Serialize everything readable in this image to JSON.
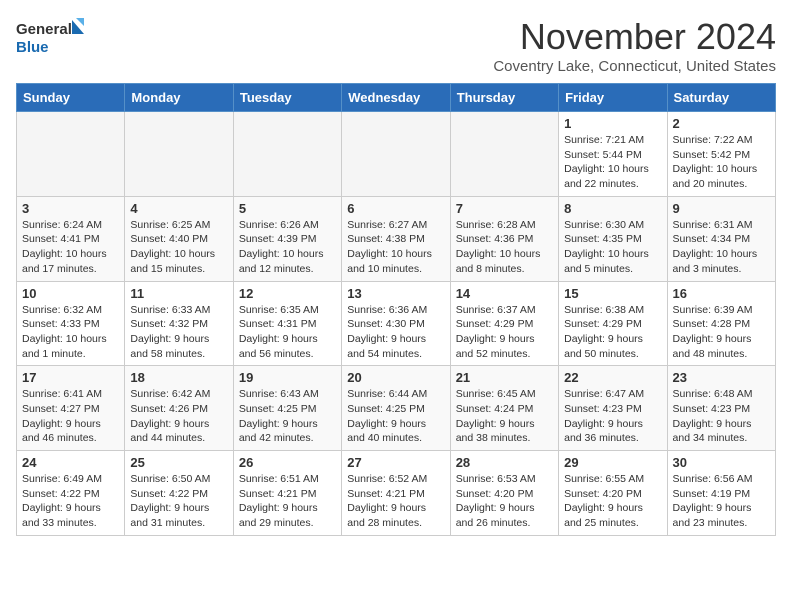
{
  "logo": {
    "line1": "General",
    "line2": "Blue"
  },
  "title": "November 2024",
  "subtitle": "Coventry Lake, Connecticut, United States",
  "days_of_week": [
    "Sunday",
    "Monday",
    "Tuesday",
    "Wednesday",
    "Thursday",
    "Friday",
    "Saturday"
  ],
  "weeks": [
    [
      {
        "day": "",
        "info": ""
      },
      {
        "day": "",
        "info": ""
      },
      {
        "day": "",
        "info": ""
      },
      {
        "day": "",
        "info": ""
      },
      {
        "day": "",
        "info": ""
      },
      {
        "day": "1",
        "info": "Sunrise: 7:21 AM\nSunset: 5:44 PM\nDaylight: 10 hours and 22 minutes."
      },
      {
        "day": "2",
        "info": "Sunrise: 7:22 AM\nSunset: 5:42 PM\nDaylight: 10 hours and 20 minutes."
      }
    ],
    [
      {
        "day": "3",
        "info": "Sunrise: 6:24 AM\nSunset: 4:41 PM\nDaylight: 10 hours and 17 minutes."
      },
      {
        "day": "4",
        "info": "Sunrise: 6:25 AM\nSunset: 4:40 PM\nDaylight: 10 hours and 15 minutes."
      },
      {
        "day": "5",
        "info": "Sunrise: 6:26 AM\nSunset: 4:39 PM\nDaylight: 10 hours and 12 minutes."
      },
      {
        "day": "6",
        "info": "Sunrise: 6:27 AM\nSunset: 4:38 PM\nDaylight: 10 hours and 10 minutes."
      },
      {
        "day": "7",
        "info": "Sunrise: 6:28 AM\nSunset: 4:36 PM\nDaylight: 10 hours and 8 minutes."
      },
      {
        "day": "8",
        "info": "Sunrise: 6:30 AM\nSunset: 4:35 PM\nDaylight: 10 hours and 5 minutes."
      },
      {
        "day": "9",
        "info": "Sunrise: 6:31 AM\nSunset: 4:34 PM\nDaylight: 10 hours and 3 minutes."
      }
    ],
    [
      {
        "day": "10",
        "info": "Sunrise: 6:32 AM\nSunset: 4:33 PM\nDaylight: 10 hours and 1 minute."
      },
      {
        "day": "11",
        "info": "Sunrise: 6:33 AM\nSunset: 4:32 PM\nDaylight: 9 hours and 58 minutes."
      },
      {
        "day": "12",
        "info": "Sunrise: 6:35 AM\nSunset: 4:31 PM\nDaylight: 9 hours and 56 minutes."
      },
      {
        "day": "13",
        "info": "Sunrise: 6:36 AM\nSunset: 4:30 PM\nDaylight: 9 hours and 54 minutes."
      },
      {
        "day": "14",
        "info": "Sunrise: 6:37 AM\nSunset: 4:29 PM\nDaylight: 9 hours and 52 minutes."
      },
      {
        "day": "15",
        "info": "Sunrise: 6:38 AM\nSunset: 4:29 PM\nDaylight: 9 hours and 50 minutes."
      },
      {
        "day": "16",
        "info": "Sunrise: 6:39 AM\nSunset: 4:28 PM\nDaylight: 9 hours and 48 minutes."
      }
    ],
    [
      {
        "day": "17",
        "info": "Sunrise: 6:41 AM\nSunset: 4:27 PM\nDaylight: 9 hours and 46 minutes."
      },
      {
        "day": "18",
        "info": "Sunrise: 6:42 AM\nSunset: 4:26 PM\nDaylight: 9 hours and 44 minutes."
      },
      {
        "day": "19",
        "info": "Sunrise: 6:43 AM\nSunset: 4:25 PM\nDaylight: 9 hours and 42 minutes."
      },
      {
        "day": "20",
        "info": "Sunrise: 6:44 AM\nSunset: 4:25 PM\nDaylight: 9 hours and 40 minutes."
      },
      {
        "day": "21",
        "info": "Sunrise: 6:45 AM\nSunset: 4:24 PM\nDaylight: 9 hours and 38 minutes."
      },
      {
        "day": "22",
        "info": "Sunrise: 6:47 AM\nSunset: 4:23 PM\nDaylight: 9 hours and 36 minutes."
      },
      {
        "day": "23",
        "info": "Sunrise: 6:48 AM\nSunset: 4:23 PM\nDaylight: 9 hours and 34 minutes."
      }
    ],
    [
      {
        "day": "24",
        "info": "Sunrise: 6:49 AM\nSunset: 4:22 PM\nDaylight: 9 hours and 33 minutes."
      },
      {
        "day": "25",
        "info": "Sunrise: 6:50 AM\nSunset: 4:22 PM\nDaylight: 9 hours and 31 minutes."
      },
      {
        "day": "26",
        "info": "Sunrise: 6:51 AM\nSunset: 4:21 PM\nDaylight: 9 hours and 29 minutes."
      },
      {
        "day": "27",
        "info": "Sunrise: 6:52 AM\nSunset: 4:21 PM\nDaylight: 9 hours and 28 minutes."
      },
      {
        "day": "28",
        "info": "Sunrise: 6:53 AM\nSunset: 4:20 PM\nDaylight: 9 hours and 26 minutes."
      },
      {
        "day": "29",
        "info": "Sunrise: 6:55 AM\nSunset: 4:20 PM\nDaylight: 9 hours and 25 minutes."
      },
      {
        "day": "30",
        "info": "Sunrise: 6:56 AM\nSunset: 4:19 PM\nDaylight: 9 hours and 23 minutes."
      }
    ]
  ]
}
